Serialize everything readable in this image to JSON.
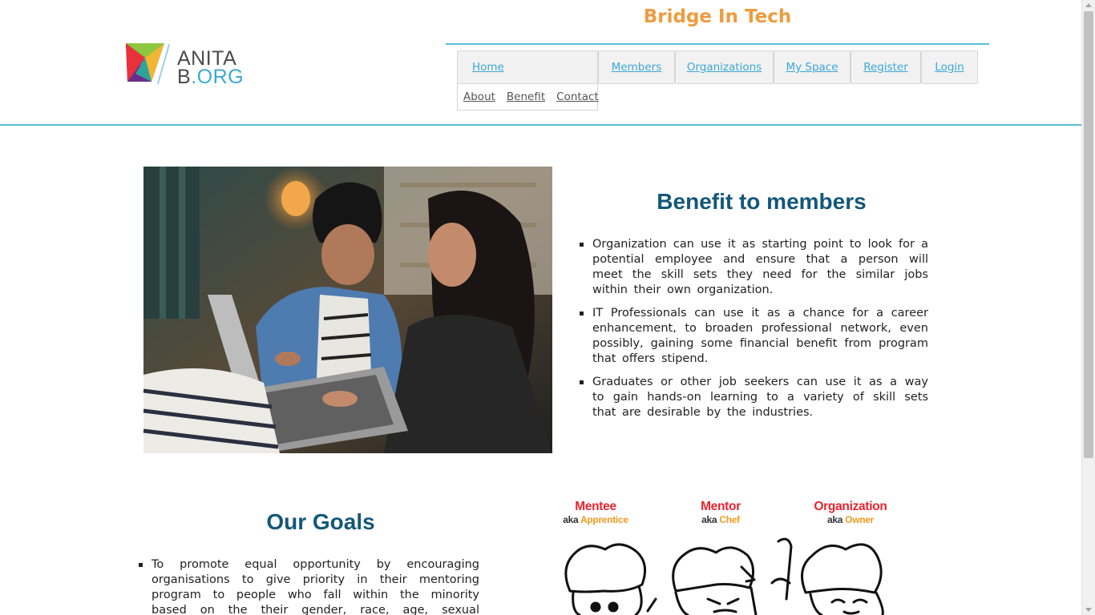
{
  "header": {
    "logo": {
      "line1": "ANITA",
      "line2_b": "B",
      "line2_dot": ".",
      "line2_org": "ORG"
    },
    "site_title": "Bridge In Tech"
  },
  "nav": {
    "items": [
      {
        "label": "Home"
      },
      {
        "label": "Members"
      },
      {
        "label": "Organizations"
      },
      {
        "label": "My Space"
      },
      {
        "label": "Register"
      },
      {
        "label": "Login"
      }
    ],
    "sub_items": [
      {
        "label": "About"
      },
      {
        "label": "Benefit"
      },
      {
        "label": "Contact"
      }
    ]
  },
  "benefit": {
    "title": "Benefit to members",
    "items": [
      "Organization can use it as starting point to look for a potential employee and ensure that a person will meet the skill sets they need for the similar jobs within their own organization.",
      "IT Professionals can use it as a chance for a career enhancement, to broaden professional network, even possibly, gaining some financial benefit from program that offers stipend.",
      "Graduates or other job seekers can use it as a way to gain hands-on learning to a variety of skill sets that are desirable by the industries."
    ]
  },
  "goals": {
    "title": "Our Goals",
    "items": [
      "To promote equal opportunity by encouraging organisations to give priority in their mentoring program to people who fall within the minority based on the their gender, race, age, sexual orientation,"
    ]
  },
  "roles": [
    {
      "name": "Mentee",
      "aka": "aka",
      "alias": "Apprentice"
    },
    {
      "name": "Mentor",
      "aka": "aka",
      "alias": "Chef"
    },
    {
      "name": "Organization",
      "aka": "aka",
      "alias": "Owner"
    }
  ],
  "colors": {
    "title_orange": "#ef9b3e",
    "heading_blue": "#14577a",
    "accent_line": "#5bbcd6",
    "link_blue": "#3aa8d8",
    "role_red": "#e8232e",
    "role_orange": "#f29a1f"
  }
}
